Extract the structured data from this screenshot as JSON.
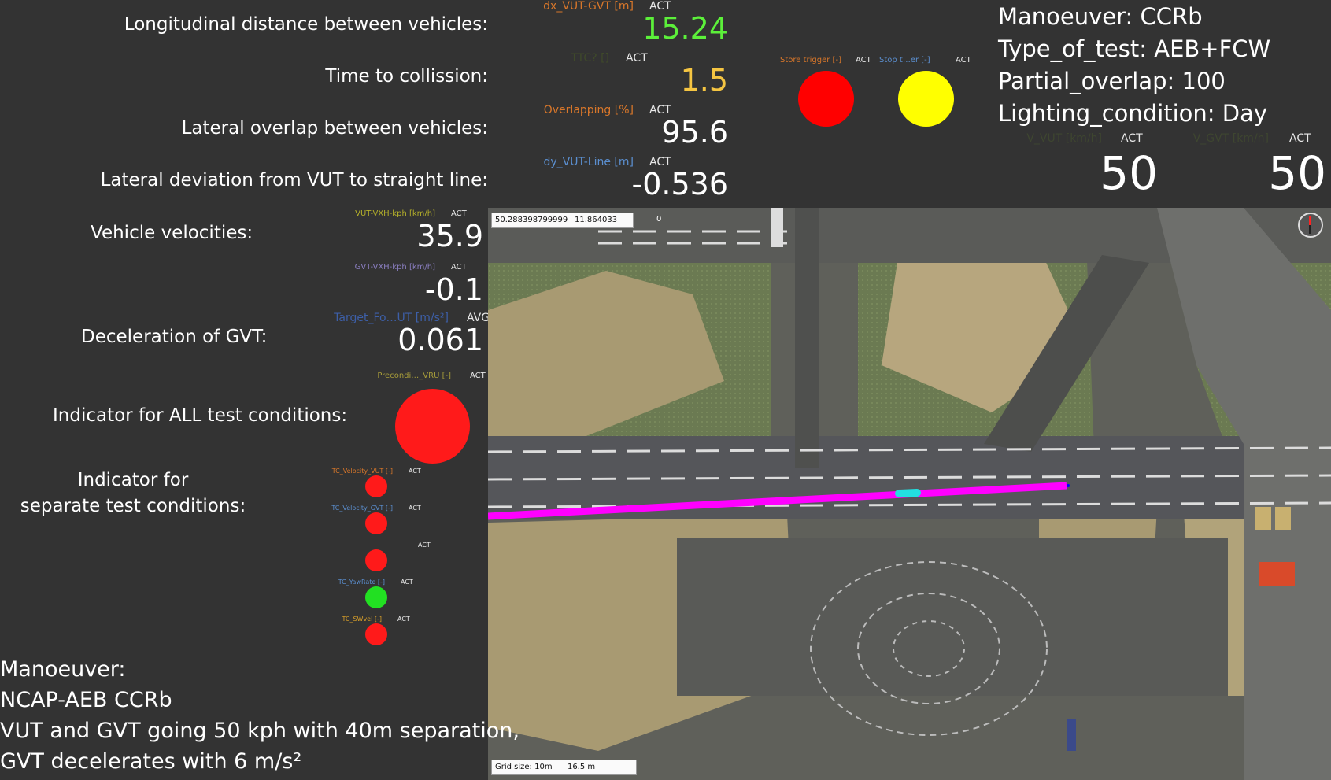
{
  "labels": {
    "long_dist": "Longitudinal distance between vehicles:",
    "ttc": "Time to collission:",
    "lat_overlap": "Lateral overlap between vehicles:",
    "lat_dev": "Lateral deviation from VUT to straight line:",
    "velocities": "Vehicle velocities:",
    "decel": "Deceleration of GVT:",
    "all_ind": "Indicator for ALL test conditions:",
    "sep_ind_1": "Indicator for",
    "sep_ind_2": "separate test conditions:"
  },
  "signals": {
    "dx": {
      "name": "dx_VUT-GVT [m]",
      "mode": "ACT",
      "value": "15.24",
      "color": "#5cf03a"
    },
    "ttc": {
      "name": "TTC? []",
      "mode": "ACT",
      "value": "1.5",
      "color": "#f5c542"
    },
    "overlap": {
      "name": "Overlapping [%]",
      "mode": "ACT",
      "value": "95.6"
    },
    "dy": {
      "name": "dy_VUT-Line [m]",
      "mode": "ACT",
      "value": "-0.536"
    },
    "vut_v": {
      "name": "VUT-VXH-kph [km/h]",
      "mode": "ACT",
      "value": "35.9"
    },
    "gvt_v": {
      "name": "GVT-VXH-kph [km/h]",
      "mode": "ACT",
      "value": "-0.1"
    },
    "target_f": {
      "name": "Target_Fo…UT [m/s²]",
      "mode": "AVG",
      "value": "0.061"
    },
    "precond": {
      "name": "Precondi…_VRU [-]",
      "mode": "ACT"
    }
  },
  "triggers": {
    "store": {
      "name": "Store trigger [-]",
      "mode": "ACT",
      "color": "#ff0000"
    },
    "stop": {
      "name": "Stop t…er [-]",
      "mode": "ACT",
      "color": "#ffff00"
    }
  },
  "test_conditions": [
    {
      "name": "TC_Velocity_VUT [-]",
      "mode": "ACT",
      "color": "#ff1a1a"
    },
    {
      "name": "TC_Velocity_GVT [-]",
      "mode": "ACT",
      "color": "#ff1a1a"
    },
    {
      "name": "",
      "mode": "ACT",
      "color": "#ff1a1a"
    },
    {
      "name": "TC_YawRate [-]",
      "mode": "ACT",
      "color": "#22e022"
    },
    {
      "name": "TC_SWvel [-]",
      "mode": "ACT",
      "color": "#ff1a1a"
    }
  ],
  "test_info": {
    "manoeuver": "Manoeuver: CCRb",
    "type": "Type_of_test: AEB+FCW",
    "overlap": "Partial_overlap: 100",
    "lighting": "Lighting_condition: Day"
  },
  "speeds": {
    "vut": {
      "name": "V_VUT [km/h]",
      "mode": "ACT",
      "value": "50"
    },
    "gvt": {
      "name": "V_GVT [km/h]",
      "mode": "ACT",
      "value": "50"
    }
  },
  "map": {
    "lat": "50.288398799999",
    "lon": "11.864033",
    "third": "0",
    "grid_size": "Grid size: 10m",
    "scale": "16.5 m"
  },
  "notes": {
    "l1": "Manoeuver:",
    "l2": "NCAP-AEB CCRb",
    "l3": "VUT and GVT going 50 kph with 40m separation,",
    "l4": "GVT decelerates with 6 m/s²"
  },
  "colors": {
    "background": "#333333",
    "indicator_red": "#ff1a1a",
    "indicator_green": "#22e022",
    "trajectory": "#ff00ff",
    "vehicle_marker": "#22e0e0"
  }
}
